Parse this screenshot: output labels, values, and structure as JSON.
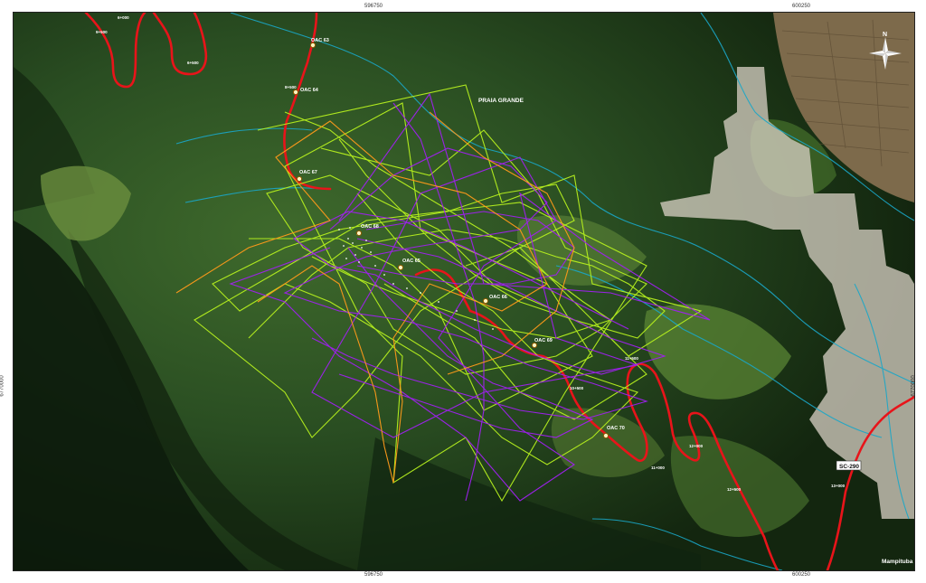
{
  "map": {
    "coords": {
      "top_left": "596750",
      "top_right": "600250",
      "bottom_left": "596750",
      "bottom_right": "600250",
      "left": "6770000",
      "right": "6770000"
    },
    "place_labels": {
      "praia_grande": "PRAIA GRANDE",
      "mampituba": "Mampituba",
      "road_badge": "SC-290"
    },
    "compass": {
      "north": "N"
    },
    "stations": [
      {
        "id": "s1",
        "label": "OAC 63"
      },
      {
        "id": "s2",
        "label": "OAC 64"
      },
      {
        "id": "s3",
        "label": "OAC 67"
      },
      {
        "id": "s4",
        "label": "OAC 68"
      },
      {
        "id": "s5",
        "label": "OAC 65"
      },
      {
        "id": "s6",
        "label": "OAC 66"
      },
      {
        "id": "s7",
        "label": "OAC 69"
      },
      {
        "id": "s8",
        "label": "OAC 70"
      }
    ],
    "km_markers": [
      {
        "id": "k1",
        "label": "6+000"
      },
      {
        "id": "k2",
        "label": "9+500"
      },
      {
        "id": "k3",
        "label": "6+500"
      },
      {
        "id": "k4",
        "label": "8+500"
      },
      {
        "id": "k5",
        "label": "11+500"
      },
      {
        "id": "k6",
        "label": "10+500"
      },
      {
        "id": "k7",
        "label": "12+000"
      },
      {
        "id": "k8",
        "label": "11+000"
      },
      {
        "id": "k9",
        "label": "12+500"
      },
      {
        "id": "k10",
        "label": "13+000"
      }
    ],
    "colors": {
      "track_lime": "#b6f01e",
      "track_purple": "#a020f0",
      "track_orange": "#ff9a1a",
      "road": "#e8141a",
      "river": "#1aa7c8",
      "urban": "#d9d2c5"
    }
  }
}
